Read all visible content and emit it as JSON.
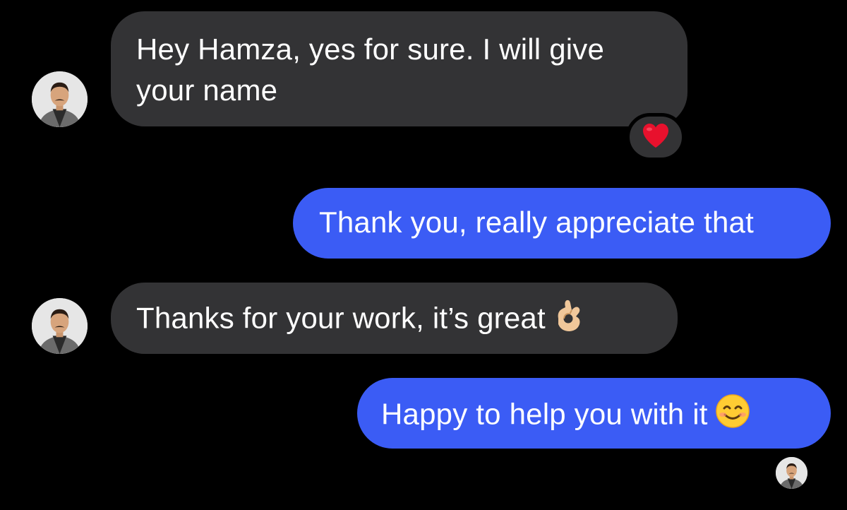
{
  "messages": [
    {
      "direction": "incoming",
      "lines": [
        "Hey Hamza, yes for sure. I will give",
        "your name"
      ],
      "reaction": "heart-emoji"
    },
    {
      "direction": "outgoing",
      "text": "Thank you, really appreciate that"
    },
    {
      "direction": "incoming",
      "text": "Thanks for your work, it’s great",
      "emoji": "ok-hand-emoji"
    },
    {
      "direction": "outgoing",
      "text": "Happy to help you with it",
      "emoji": "smiling-face-emoji"
    }
  ],
  "colors": {
    "background": "#000000",
    "incoming_bubble": "#333335",
    "outgoing_bubble": "#3b5cf5",
    "text": "#ffffff",
    "reaction_heart": "#e8112d"
  },
  "icons": [
    "contact-avatar",
    "heart-emoji",
    "ok-hand-emoji",
    "smiling-face-emoji",
    "seen-avatar"
  ]
}
